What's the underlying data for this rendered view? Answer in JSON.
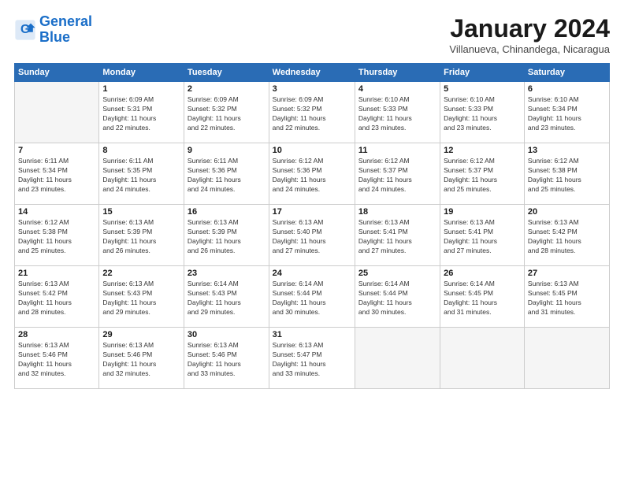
{
  "logo": {
    "line1": "General",
    "line2": "Blue"
  },
  "title": "January 2024",
  "subtitle": "Villanueva, Chinandega, Nicaragua",
  "days_of_week": [
    "Sunday",
    "Monday",
    "Tuesday",
    "Wednesday",
    "Thursday",
    "Friday",
    "Saturday"
  ],
  "weeks": [
    [
      {
        "day": "",
        "sunrise": "",
        "sunset": "",
        "daylight": ""
      },
      {
        "day": "1",
        "sunrise": "Sunrise: 6:09 AM",
        "sunset": "Sunset: 5:31 PM",
        "daylight": "Daylight: 11 hours and 22 minutes."
      },
      {
        "day": "2",
        "sunrise": "Sunrise: 6:09 AM",
        "sunset": "Sunset: 5:32 PM",
        "daylight": "Daylight: 11 hours and 22 minutes."
      },
      {
        "day": "3",
        "sunrise": "Sunrise: 6:09 AM",
        "sunset": "Sunset: 5:32 PM",
        "daylight": "Daylight: 11 hours and 22 minutes."
      },
      {
        "day": "4",
        "sunrise": "Sunrise: 6:10 AM",
        "sunset": "Sunset: 5:33 PM",
        "daylight": "Daylight: 11 hours and 23 minutes."
      },
      {
        "day": "5",
        "sunrise": "Sunrise: 6:10 AM",
        "sunset": "Sunset: 5:33 PM",
        "daylight": "Daylight: 11 hours and 23 minutes."
      },
      {
        "day": "6",
        "sunrise": "Sunrise: 6:10 AM",
        "sunset": "Sunset: 5:34 PM",
        "daylight": "Daylight: 11 hours and 23 minutes."
      }
    ],
    [
      {
        "day": "7",
        "sunrise": "Sunrise: 6:11 AM",
        "sunset": "Sunset: 5:34 PM",
        "daylight": "Daylight: 11 hours and 23 minutes."
      },
      {
        "day": "8",
        "sunrise": "Sunrise: 6:11 AM",
        "sunset": "Sunset: 5:35 PM",
        "daylight": "Daylight: 11 hours and 24 minutes."
      },
      {
        "day": "9",
        "sunrise": "Sunrise: 6:11 AM",
        "sunset": "Sunset: 5:36 PM",
        "daylight": "Daylight: 11 hours and 24 minutes."
      },
      {
        "day": "10",
        "sunrise": "Sunrise: 6:12 AM",
        "sunset": "Sunset: 5:36 PM",
        "daylight": "Daylight: 11 hours and 24 minutes."
      },
      {
        "day": "11",
        "sunrise": "Sunrise: 6:12 AM",
        "sunset": "Sunset: 5:37 PM",
        "daylight": "Daylight: 11 hours and 24 minutes."
      },
      {
        "day": "12",
        "sunrise": "Sunrise: 6:12 AM",
        "sunset": "Sunset: 5:37 PM",
        "daylight": "Daylight: 11 hours and 25 minutes."
      },
      {
        "day": "13",
        "sunrise": "Sunrise: 6:12 AM",
        "sunset": "Sunset: 5:38 PM",
        "daylight": "Daylight: 11 hours and 25 minutes."
      }
    ],
    [
      {
        "day": "14",
        "sunrise": "Sunrise: 6:12 AM",
        "sunset": "Sunset: 5:38 PM",
        "daylight": "Daylight: 11 hours and 25 minutes."
      },
      {
        "day": "15",
        "sunrise": "Sunrise: 6:13 AM",
        "sunset": "Sunset: 5:39 PM",
        "daylight": "Daylight: 11 hours and 26 minutes."
      },
      {
        "day": "16",
        "sunrise": "Sunrise: 6:13 AM",
        "sunset": "Sunset: 5:39 PM",
        "daylight": "Daylight: 11 hours and 26 minutes."
      },
      {
        "day": "17",
        "sunrise": "Sunrise: 6:13 AM",
        "sunset": "Sunset: 5:40 PM",
        "daylight": "Daylight: 11 hours and 27 minutes."
      },
      {
        "day": "18",
        "sunrise": "Sunrise: 6:13 AM",
        "sunset": "Sunset: 5:41 PM",
        "daylight": "Daylight: 11 hours and 27 minutes."
      },
      {
        "day": "19",
        "sunrise": "Sunrise: 6:13 AM",
        "sunset": "Sunset: 5:41 PM",
        "daylight": "Daylight: 11 hours and 27 minutes."
      },
      {
        "day": "20",
        "sunrise": "Sunrise: 6:13 AM",
        "sunset": "Sunset: 5:42 PM",
        "daylight": "Daylight: 11 hours and 28 minutes."
      }
    ],
    [
      {
        "day": "21",
        "sunrise": "Sunrise: 6:13 AM",
        "sunset": "Sunset: 5:42 PM",
        "daylight": "Daylight: 11 hours and 28 minutes."
      },
      {
        "day": "22",
        "sunrise": "Sunrise: 6:13 AM",
        "sunset": "Sunset: 5:43 PM",
        "daylight": "Daylight: 11 hours and 29 minutes."
      },
      {
        "day": "23",
        "sunrise": "Sunrise: 6:14 AM",
        "sunset": "Sunset: 5:43 PM",
        "daylight": "Daylight: 11 hours and 29 minutes."
      },
      {
        "day": "24",
        "sunrise": "Sunrise: 6:14 AM",
        "sunset": "Sunset: 5:44 PM",
        "daylight": "Daylight: 11 hours and 30 minutes."
      },
      {
        "day": "25",
        "sunrise": "Sunrise: 6:14 AM",
        "sunset": "Sunset: 5:44 PM",
        "daylight": "Daylight: 11 hours and 30 minutes."
      },
      {
        "day": "26",
        "sunrise": "Sunrise: 6:14 AM",
        "sunset": "Sunset: 5:45 PM",
        "daylight": "Daylight: 11 hours and 31 minutes."
      },
      {
        "day": "27",
        "sunrise": "Sunrise: 6:13 AM",
        "sunset": "Sunset: 5:45 PM",
        "daylight": "Daylight: 11 hours and 31 minutes."
      }
    ],
    [
      {
        "day": "28",
        "sunrise": "Sunrise: 6:13 AM",
        "sunset": "Sunset: 5:46 PM",
        "daylight": "Daylight: 11 hours and 32 minutes."
      },
      {
        "day": "29",
        "sunrise": "Sunrise: 6:13 AM",
        "sunset": "Sunset: 5:46 PM",
        "daylight": "Daylight: 11 hours and 32 minutes."
      },
      {
        "day": "30",
        "sunrise": "Sunrise: 6:13 AM",
        "sunset": "Sunset: 5:46 PM",
        "daylight": "Daylight: 11 hours and 33 minutes."
      },
      {
        "day": "31",
        "sunrise": "Sunrise: 6:13 AM",
        "sunset": "Sunset: 5:47 PM",
        "daylight": "Daylight: 11 hours and 33 minutes."
      },
      {
        "day": "",
        "sunrise": "",
        "sunset": "",
        "daylight": ""
      },
      {
        "day": "",
        "sunrise": "",
        "sunset": "",
        "daylight": ""
      },
      {
        "day": "",
        "sunrise": "",
        "sunset": "",
        "daylight": ""
      }
    ]
  ]
}
